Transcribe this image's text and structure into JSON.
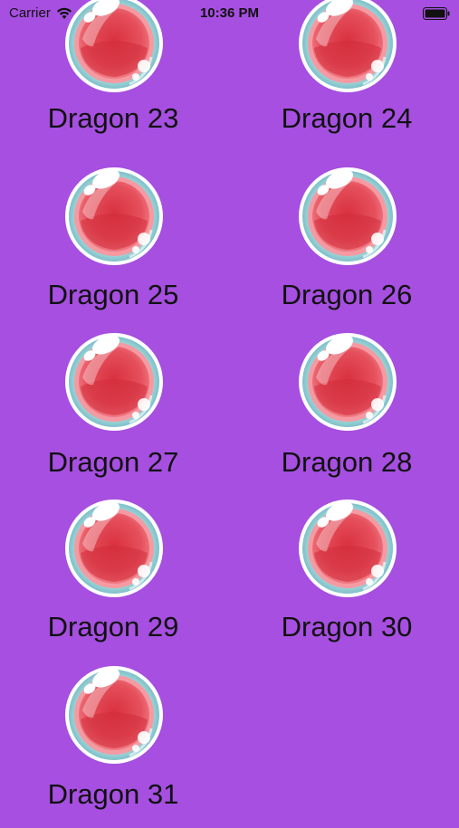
{
  "status_bar": {
    "carrier": "Carrier",
    "time": "10:36 PM",
    "icons": [
      "wifi-icon",
      "battery-icon"
    ]
  },
  "dragons": [
    {
      "label": "Dragon 23"
    },
    {
      "label": "Dragon 24"
    },
    {
      "label": "Dragon 25"
    },
    {
      "label": "Dragon 26"
    },
    {
      "label": "Dragon 27"
    },
    {
      "label": "Dragon 28"
    },
    {
      "label": "Dragon 29"
    },
    {
      "label": "Dragon 30"
    },
    {
      "label": "Dragon 31"
    }
  ],
  "colors": {
    "background": "#a64fe0",
    "orb_red": "#e0404f",
    "orb_ring": "#9fd4d8"
  }
}
